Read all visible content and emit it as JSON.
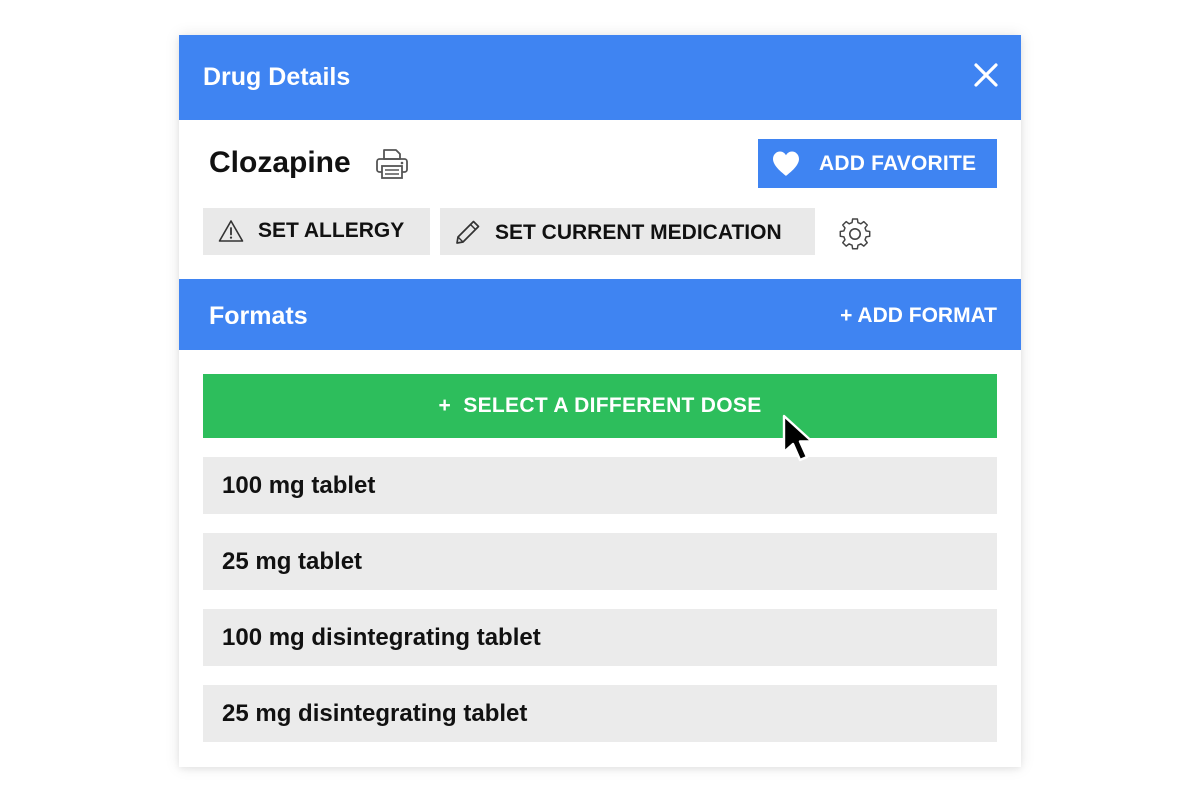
{
  "header": {
    "title": "Drug Details",
    "close_icon": "close-icon"
  },
  "drug": {
    "name": "Clozapine",
    "print_icon": "print-icon"
  },
  "actions": {
    "favorite_label": "ADD FAVORITE",
    "allergy_label": "SET ALLERGY",
    "current_med_label": "SET CURRENT MEDICATION",
    "settings_icon": "gear-icon"
  },
  "formats": {
    "title": "Formats",
    "add_label": "+ ADD FORMAT",
    "select_dose_label": "+  SELECT A DIFFERENT DOSE",
    "items": [
      {
        "label": "100 mg tablet"
      },
      {
        "label": "25 mg tablet"
      },
      {
        "label": "100 mg disintegrating tablet"
      },
      {
        "label": "25 mg disintegrating tablet"
      }
    ]
  },
  "colors": {
    "accent_blue": "#3f84f2",
    "accent_green": "#2dbe5c",
    "item_grey": "#ebebeb",
    "button_grey": "#e9e9e9"
  }
}
